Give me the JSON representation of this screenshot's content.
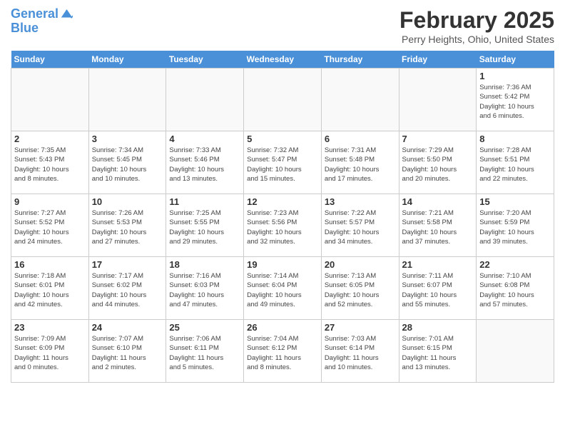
{
  "header": {
    "logo_line1": "General",
    "logo_line2": "Blue",
    "month_title": "February 2025",
    "location": "Perry Heights, Ohio, United States"
  },
  "days_of_week": [
    "Sunday",
    "Monday",
    "Tuesday",
    "Wednesday",
    "Thursday",
    "Friday",
    "Saturday"
  ],
  "weeks": [
    [
      {
        "day": "",
        "info": ""
      },
      {
        "day": "",
        "info": ""
      },
      {
        "day": "",
        "info": ""
      },
      {
        "day": "",
        "info": ""
      },
      {
        "day": "",
        "info": ""
      },
      {
        "day": "",
        "info": ""
      },
      {
        "day": "1",
        "info": "Sunrise: 7:36 AM\nSunset: 5:42 PM\nDaylight: 10 hours\nand 6 minutes."
      }
    ],
    [
      {
        "day": "2",
        "info": "Sunrise: 7:35 AM\nSunset: 5:43 PM\nDaylight: 10 hours\nand 8 minutes."
      },
      {
        "day": "3",
        "info": "Sunrise: 7:34 AM\nSunset: 5:45 PM\nDaylight: 10 hours\nand 10 minutes."
      },
      {
        "day": "4",
        "info": "Sunrise: 7:33 AM\nSunset: 5:46 PM\nDaylight: 10 hours\nand 13 minutes."
      },
      {
        "day": "5",
        "info": "Sunrise: 7:32 AM\nSunset: 5:47 PM\nDaylight: 10 hours\nand 15 minutes."
      },
      {
        "day": "6",
        "info": "Sunrise: 7:31 AM\nSunset: 5:48 PM\nDaylight: 10 hours\nand 17 minutes."
      },
      {
        "day": "7",
        "info": "Sunrise: 7:29 AM\nSunset: 5:50 PM\nDaylight: 10 hours\nand 20 minutes."
      },
      {
        "day": "8",
        "info": "Sunrise: 7:28 AM\nSunset: 5:51 PM\nDaylight: 10 hours\nand 22 minutes."
      }
    ],
    [
      {
        "day": "9",
        "info": "Sunrise: 7:27 AM\nSunset: 5:52 PM\nDaylight: 10 hours\nand 24 minutes."
      },
      {
        "day": "10",
        "info": "Sunrise: 7:26 AM\nSunset: 5:53 PM\nDaylight: 10 hours\nand 27 minutes."
      },
      {
        "day": "11",
        "info": "Sunrise: 7:25 AM\nSunset: 5:55 PM\nDaylight: 10 hours\nand 29 minutes."
      },
      {
        "day": "12",
        "info": "Sunrise: 7:23 AM\nSunset: 5:56 PM\nDaylight: 10 hours\nand 32 minutes."
      },
      {
        "day": "13",
        "info": "Sunrise: 7:22 AM\nSunset: 5:57 PM\nDaylight: 10 hours\nand 34 minutes."
      },
      {
        "day": "14",
        "info": "Sunrise: 7:21 AM\nSunset: 5:58 PM\nDaylight: 10 hours\nand 37 minutes."
      },
      {
        "day": "15",
        "info": "Sunrise: 7:20 AM\nSunset: 5:59 PM\nDaylight: 10 hours\nand 39 minutes."
      }
    ],
    [
      {
        "day": "16",
        "info": "Sunrise: 7:18 AM\nSunset: 6:01 PM\nDaylight: 10 hours\nand 42 minutes."
      },
      {
        "day": "17",
        "info": "Sunrise: 7:17 AM\nSunset: 6:02 PM\nDaylight: 10 hours\nand 44 minutes."
      },
      {
        "day": "18",
        "info": "Sunrise: 7:16 AM\nSunset: 6:03 PM\nDaylight: 10 hours\nand 47 minutes."
      },
      {
        "day": "19",
        "info": "Sunrise: 7:14 AM\nSunset: 6:04 PM\nDaylight: 10 hours\nand 49 minutes."
      },
      {
        "day": "20",
        "info": "Sunrise: 7:13 AM\nSunset: 6:05 PM\nDaylight: 10 hours\nand 52 minutes."
      },
      {
        "day": "21",
        "info": "Sunrise: 7:11 AM\nSunset: 6:07 PM\nDaylight: 10 hours\nand 55 minutes."
      },
      {
        "day": "22",
        "info": "Sunrise: 7:10 AM\nSunset: 6:08 PM\nDaylight: 10 hours\nand 57 minutes."
      }
    ],
    [
      {
        "day": "23",
        "info": "Sunrise: 7:09 AM\nSunset: 6:09 PM\nDaylight: 11 hours\nand 0 minutes."
      },
      {
        "day": "24",
        "info": "Sunrise: 7:07 AM\nSunset: 6:10 PM\nDaylight: 11 hours\nand 2 minutes."
      },
      {
        "day": "25",
        "info": "Sunrise: 7:06 AM\nSunset: 6:11 PM\nDaylight: 11 hours\nand 5 minutes."
      },
      {
        "day": "26",
        "info": "Sunrise: 7:04 AM\nSunset: 6:12 PM\nDaylight: 11 hours\nand 8 minutes."
      },
      {
        "day": "27",
        "info": "Sunrise: 7:03 AM\nSunset: 6:14 PM\nDaylight: 11 hours\nand 10 minutes."
      },
      {
        "day": "28",
        "info": "Sunrise: 7:01 AM\nSunset: 6:15 PM\nDaylight: 11 hours\nand 13 minutes."
      },
      {
        "day": "",
        "info": ""
      }
    ]
  ]
}
